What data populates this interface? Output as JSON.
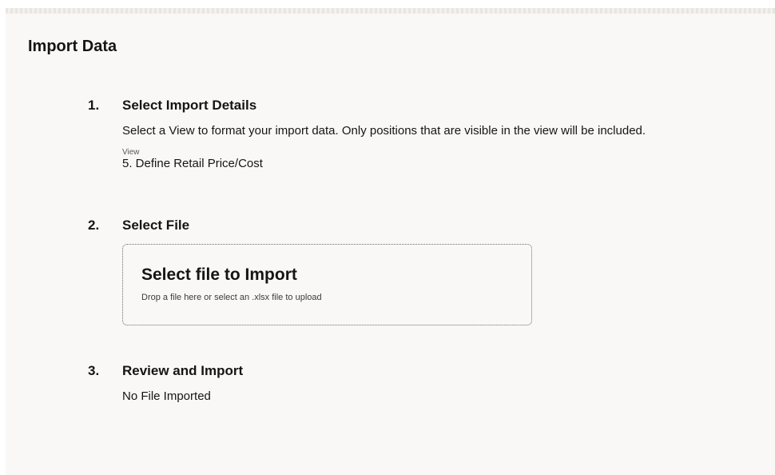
{
  "page": {
    "title": "Import Data"
  },
  "steps": [
    {
      "number": "1.",
      "title": "Select Import Details",
      "description": "Select a View to format your import data. Only positions that are visible in the view will be included.",
      "view_label": "View",
      "view_value": "5. Define Retail Price/Cost"
    },
    {
      "number": "2.",
      "title": "Select File",
      "dropzone_title": "Select file to Import",
      "dropzone_hint": "Drop a file here or select an .xlsx file to upload"
    },
    {
      "number": "3.",
      "title": "Review and Import",
      "status": "No File Imported"
    }
  ]
}
